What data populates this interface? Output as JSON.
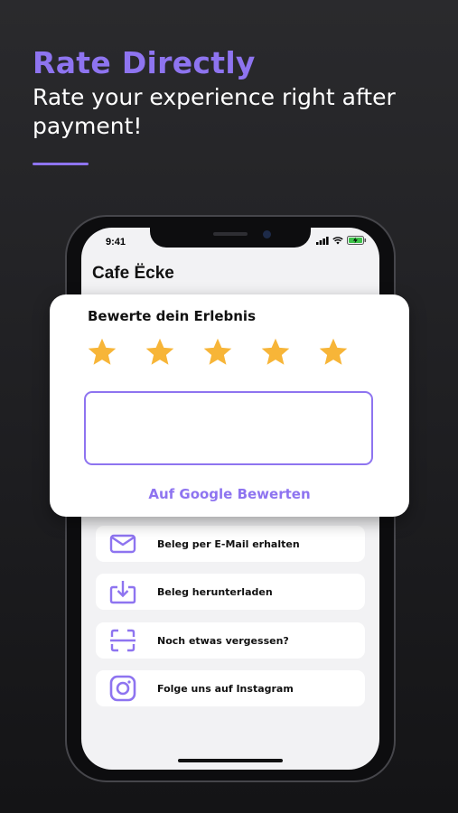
{
  "promo": {
    "headline": "Rate Directly",
    "subline": "Rate your experience right after payment!",
    "accent_color": "#8e74f0"
  },
  "status_bar": {
    "time": "9:41",
    "icons": [
      "signal-icon",
      "wifi-icon",
      "battery-charging-icon"
    ]
  },
  "app": {
    "title": "Cafe Ëcke"
  },
  "rating_card": {
    "title": "Bewerte dein Erlebnis",
    "stars": 5,
    "max_stars": 5,
    "star_color": "#f7b538",
    "review_value": "",
    "google_link": "Auf Google Bewerten"
  },
  "menu": {
    "items": [
      {
        "label": "Beleg per E-Mail erhalten",
        "icon": "mail-icon"
      },
      {
        "label": "Beleg herunterladen",
        "icon": "download-icon"
      },
      {
        "label": "Noch etwas vergessen?",
        "icon": "scan-icon"
      },
      {
        "label": "Folge uns auf Instagram",
        "icon": "instagram-icon"
      }
    ]
  }
}
